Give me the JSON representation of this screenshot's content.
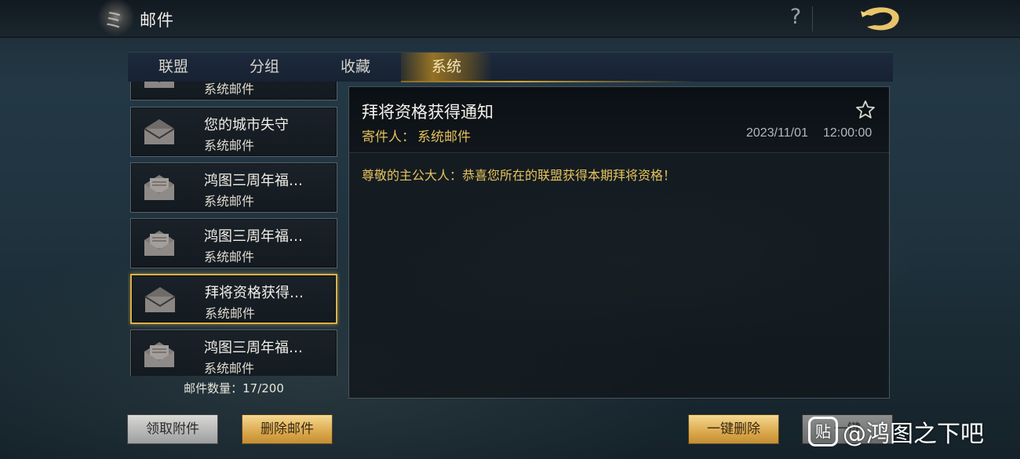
{
  "header": {
    "title": "邮件",
    "help_label": "?",
    "emblem_icon": "emblem-icon",
    "logo_icon": "dragon-logo-icon"
  },
  "tabs": [
    {
      "label": "联盟",
      "active": false
    },
    {
      "label": "分组",
      "active": false
    },
    {
      "label": "收藏",
      "active": false
    },
    {
      "label": "系统",
      "active": true
    }
  ],
  "mail_list": {
    "items": [
      {
        "subject": "",
        "sender": "系统邮件",
        "read": true
      },
      {
        "subject": "您的城市失守",
        "sender": "系统邮件",
        "read": true
      },
      {
        "subject": "鸿图三周年福…",
        "sender": "系统邮件",
        "read": false,
        "has_attachment": true
      },
      {
        "subject": "鸿图三周年福…",
        "sender": "系统邮件",
        "read": false,
        "has_attachment": true
      },
      {
        "subject": "拜将资格获得…",
        "sender": "系统邮件",
        "read": true,
        "selected": true
      },
      {
        "subject": "鸿图三周年福…",
        "sender": "系统邮件",
        "read": false,
        "has_attachment": true
      }
    ],
    "count_label": "邮件数量：17/200"
  },
  "detail": {
    "subject": "拜将资格获得通知",
    "sender_label": "寄件人：",
    "sender": "系统邮件",
    "date": "2023/11/01",
    "time": "12:00:00",
    "body": "尊敬的主公大人：恭喜您所在的联盟获得本期拜将资格！",
    "favorite_icon": "star-outline-icon"
  },
  "actions": {
    "claim_attachments": "领取附件",
    "delete_mail": "删除邮件",
    "delete_all": "一键删除",
    "last_button_partial": "一键"
  },
  "watermark": {
    "badge": "贴",
    "text": "@鸿图之下吧"
  },
  "colors": {
    "accent_gold": "#d8b24a",
    "sender_text": "#e3bf5a",
    "body_text": "#e6c35a"
  }
}
